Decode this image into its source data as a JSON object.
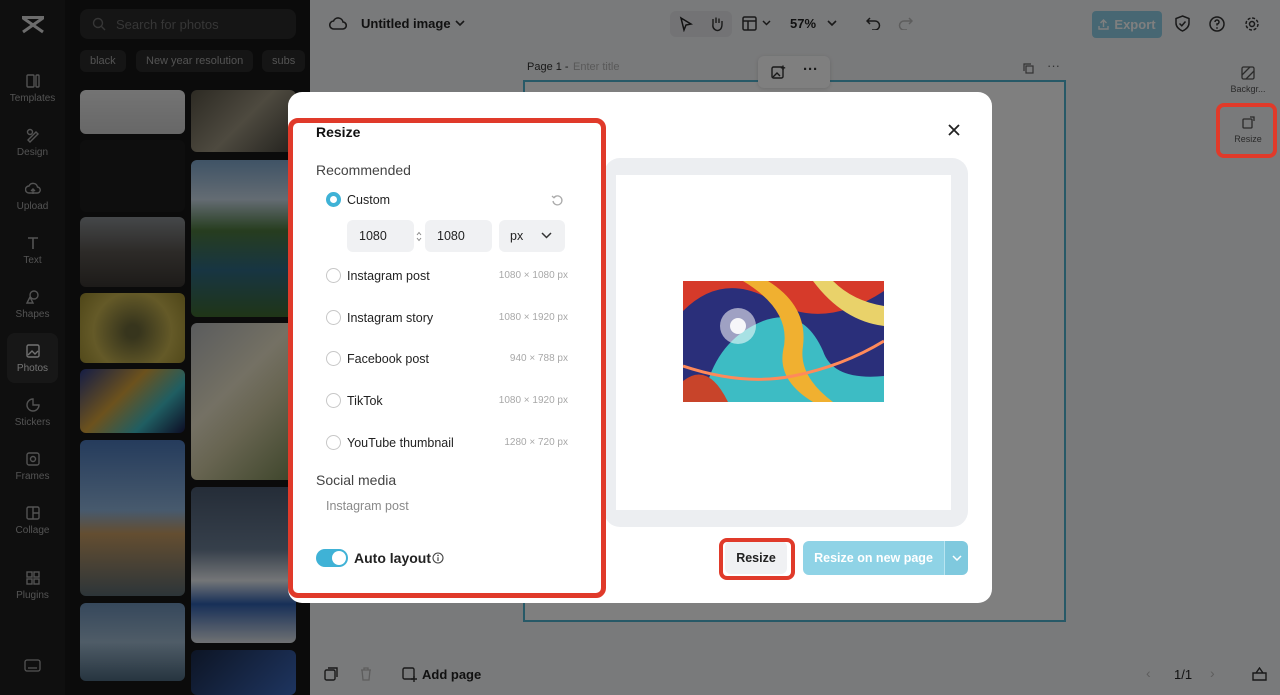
{
  "left_rail": {
    "items": [
      {
        "label": "Templates",
        "icon": "templates-icon"
      },
      {
        "label": "Design",
        "icon": "design-icon"
      },
      {
        "label": "Upload",
        "icon": "upload-icon"
      },
      {
        "label": "Text",
        "icon": "text-icon"
      },
      {
        "label": "Shapes",
        "icon": "shapes-icon"
      },
      {
        "label": "Photos",
        "icon": "photos-icon"
      },
      {
        "label": "Stickers",
        "icon": "stickers-icon"
      },
      {
        "label": "Frames",
        "icon": "frames-icon"
      },
      {
        "label": "Collage",
        "icon": "collage-icon"
      },
      {
        "label": "Plugins",
        "icon": "plugins-icon"
      }
    ],
    "active": "Photos"
  },
  "photos_panel": {
    "search_placeholder": "Search for photos",
    "chips": [
      "black",
      "New year resolution",
      "subs"
    ]
  },
  "topbar": {
    "doc_title": "Untitled image",
    "zoom": "57%",
    "export_label": "Export"
  },
  "canvas": {
    "page_label": "Page 1 -",
    "title_placeholder": "Enter title"
  },
  "right_rail": {
    "background_label": "Backgr...",
    "resize_label": "Resize"
  },
  "bottombar": {
    "add_page_label": "Add page",
    "pager": "1/1"
  },
  "modal": {
    "title": "Resize",
    "recommended_heading": "Recommended",
    "custom_label": "Custom",
    "width_value": "1080",
    "height_value": "1080",
    "unit": "px",
    "options": [
      {
        "label": "Instagram post",
        "dims": "1080 × 1080 px"
      },
      {
        "label": "Instagram story",
        "dims": "1080 × 1920 px"
      },
      {
        "label": "Facebook post",
        "dims": "940 × 788 px"
      },
      {
        "label": "TikTok",
        "dims": "1080 × 1920 px"
      },
      {
        "label": "YouTube thumbnail",
        "dims": "1280 × 720 px"
      }
    ],
    "social_heading": "Social media",
    "social_item": "Instagram post",
    "auto_layout_label": "Auto layout",
    "resize_button": "Resize",
    "resize_new_button": "Resize on new page"
  },
  "colors": {
    "accent": "#3fb2d6",
    "highlight": "#e03a2a"
  }
}
